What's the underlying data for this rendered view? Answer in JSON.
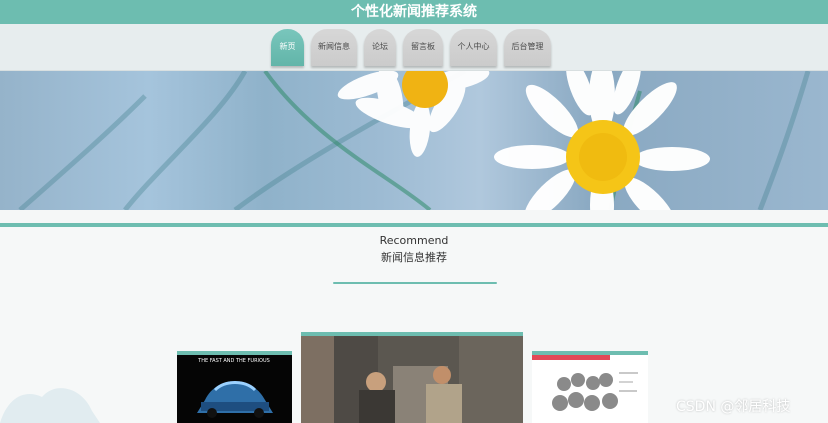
{
  "header": {
    "title": "个性化新闻推荐系统"
  },
  "nav": {
    "tabs": [
      {
        "label": "新页",
        "active": true
      },
      {
        "label": "新闻信息",
        "active": false
      },
      {
        "label": "论坛",
        "active": false
      },
      {
        "label": "留言板",
        "active": false
      },
      {
        "label": "个人中心",
        "active": false
      },
      {
        "label": "后台管理",
        "active": false
      }
    ]
  },
  "recommend": {
    "title_en": "Recommend",
    "title_zh": "新闻信息推荐"
  },
  "cards": {
    "left": {
      "poster_text": "THE FAST AND THE FURIOUS"
    }
  },
  "watermark": "CSDN @邻居科技",
  "colors": {
    "accent": "#6dbdb0",
    "nav_bg": "#e7edee",
    "tab_inactive": "#d0d0d0"
  }
}
